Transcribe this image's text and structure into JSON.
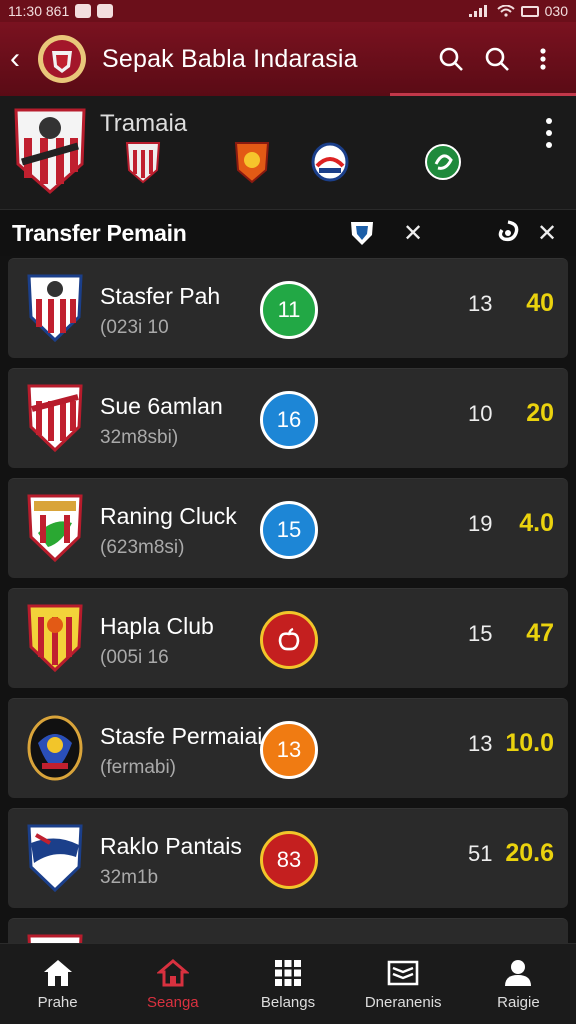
{
  "status_bar": {
    "time": "11:30 861",
    "right_text": "030"
  },
  "app_bar": {
    "title": "Sepak Babla Indarasia"
  },
  "team_header": {
    "name": "Tramaia"
  },
  "section": {
    "title": "Transfer Pemain"
  },
  "colors": {
    "accent": "#7a1220",
    "highlight": "#ead20e",
    "nav_active": "#d8313f"
  },
  "clubs": [
    {
      "name": "Stasfer Pah",
      "sub": "(023i 10",
      "badge": "11",
      "badge_color": "#22a845",
      "n1": "13",
      "n2": "40"
    },
    {
      "name": "Sue 6amlan",
      "sub": "32m8sbi)",
      "badge": "16",
      "badge_color": "#1d86d6",
      "n1": "10",
      "n2": "20"
    },
    {
      "name": "Raning Cluck",
      "sub": "(623m8si)",
      "badge": "15",
      "badge_color": "#1d86d6",
      "n1": "19",
      "n2": "4.0"
    },
    {
      "name": "Hapla Club",
      "sub": "(005i 16",
      "badge": "",
      "badge_color": "#c41f1f",
      "n1": "15",
      "n2": "47"
    },
    {
      "name": "Stasfe Permaiai",
      "sub": "(fermabi)",
      "badge": "13",
      "badge_color": "#f07b12",
      "n1": "13",
      "n2": "10.0"
    },
    {
      "name": "Raklo Pantais",
      "sub": "32m1b",
      "badge": "83",
      "badge_color": "#c41f1f",
      "n1": "51",
      "n2": "20.6"
    }
  ],
  "nav": [
    {
      "label": "Prahe",
      "icon": "home-icon"
    },
    {
      "label": "Seanga",
      "icon": "home-outline-icon",
      "active": true
    },
    {
      "label": "Belangs",
      "icon": "grid-icon"
    },
    {
      "label": "Dneranenis",
      "icon": "book-icon"
    },
    {
      "label": "Raigie",
      "icon": "person-icon"
    }
  ]
}
